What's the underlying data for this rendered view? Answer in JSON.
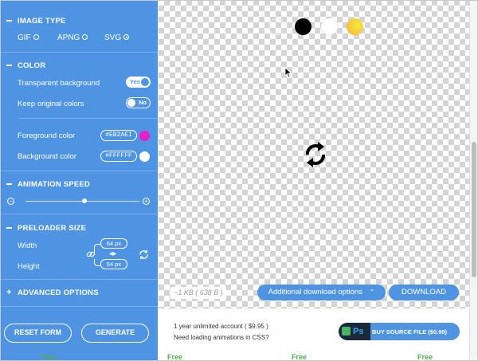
{
  "sections": {
    "image_type": {
      "title": "IMAGE TYPE",
      "options": [
        {
          "label": "GIF",
          "selected": false
        },
        {
          "label": "APNG",
          "selected": false
        },
        {
          "label": "SVG",
          "selected": true
        }
      ]
    },
    "color": {
      "title": "COLOR",
      "transparent_bg": {
        "label": "Transparent background",
        "toggle": "Yes"
      },
      "keep_original": {
        "label": "Keep original colors",
        "toggle": "No"
      },
      "foreground": {
        "label": "Foreground color",
        "value": "#EB2AEI",
        "swatch": "#e61ecb"
      },
      "background": {
        "label": "Background color",
        "value": "#FFFFFF",
        "swatch": "#ffffff"
      }
    },
    "animation_speed": {
      "title": "ANIMATION SPEED",
      "level": 0.5
    },
    "preloader_size": {
      "title": "PRELOADER SIZE",
      "width_label": "Width",
      "height_label": "Height",
      "width": "64 px",
      "height": "64 px"
    },
    "advanced": {
      "title": "ADVANCED OPTIONS"
    }
  },
  "buttons": {
    "reset": "RESET FORM",
    "generate": "GENERATE"
  },
  "preview": {
    "bg_options": [
      "transparent",
      "#000000",
      "#ffffff",
      "gradient-yellow"
    ],
    "file_size": "~1 KB ( 638 B )",
    "additional_download": "Additional download options",
    "download": "DOWNLOAD"
  },
  "footer": {
    "line1": "1 year unlimited account ( $9.95 )",
    "line2": "Need loading animations in CSS?",
    "buy_label": "BUY SOURCE FILE ($0.99)",
    "ps": "Ps"
  },
  "strip": {
    "labels": [
      "Free",
      "Free",
      "Free",
      "Free"
    ]
  },
  "colors": {
    "accent": "#4f94e3",
    "free_green": "#4caf50"
  }
}
